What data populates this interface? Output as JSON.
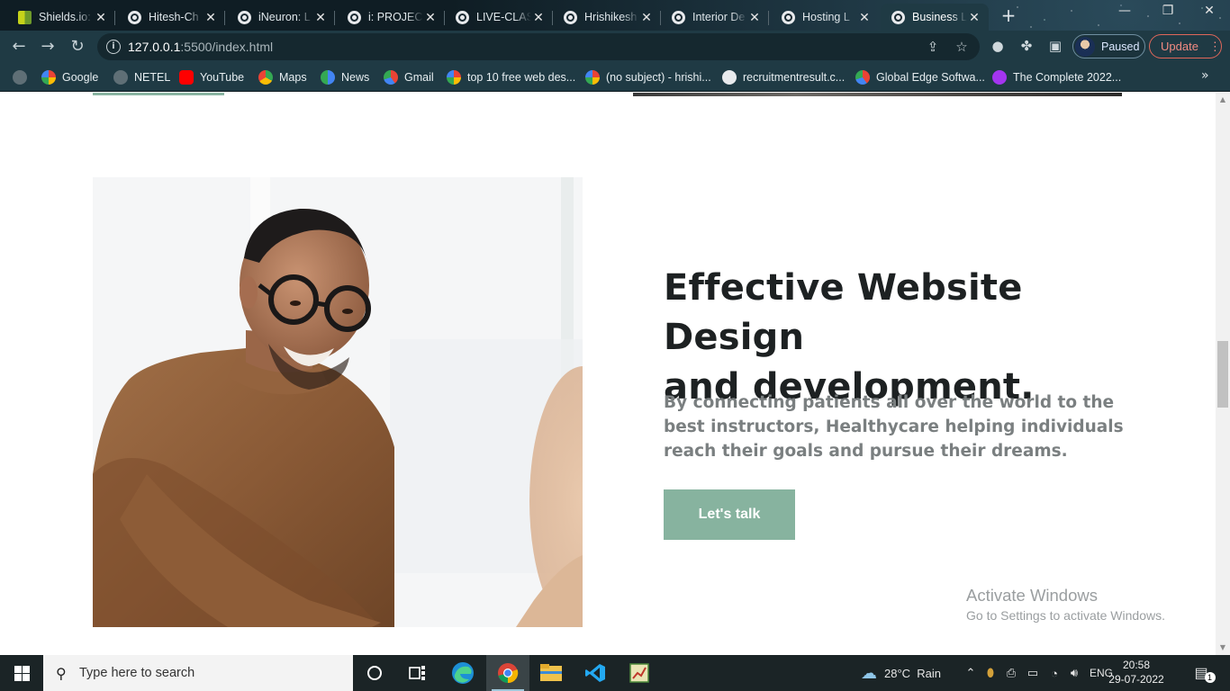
{
  "browser": {
    "tabs": [
      {
        "title": "Shields.io:",
        "icon": "shields-favicon"
      },
      {
        "title": "Hitesh-Ch",
        "icon": "globe-icon"
      },
      {
        "title": "iNeuron: L",
        "icon": "globe-icon"
      },
      {
        "title": "i: PROJECT",
        "icon": "globe-icon"
      },
      {
        "title": "LIVE-CLAS",
        "icon": "globe-icon"
      },
      {
        "title": "Hrishikesh",
        "icon": "globe-icon"
      },
      {
        "title": "Interior De",
        "icon": "globe-icon"
      },
      {
        "title": "Hosting L",
        "icon": "globe-icon"
      },
      {
        "title": "Business L",
        "icon": "globe-icon",
        "active": true
      }
    ],
    "url_host": "127.0.0.1",
    "url_path": ":5500/index.html",
    "profile_label": "Paused",
    "update_label": "Update",
    "bookmarks": [
      {
        "label": "",
        "icon": "globe-icon"
      },
      {
        "label": "Google",
        "icon": "google-icon"
      },
      {
        "label": "NETEL",
        "icon": "globe-icon"
      },
      {
        "label": "YouTube",
        "icon": "youtube-icon"
      },
      {
        "label": "Maps",
        "icon": "maps-icon"
      },
      {
        "label": "News",
        "icon": "news-icon"
      },
      {
        "label": "Gmail",
        "icon": "gmail-icon"
      },
      {
        "label": "top 10 free web des...",
        "icon": "google-icon"
      },
      {
        "label": "(no subject) - hrishi...",
        "icon": "google-icon"
      },
      {
        "label": "recruitmentresult.c...",
        "icon": "wordpress-icon"
      },
      {
        "label": "Global Edge Softwa...",
        "icon": "gmail-icon"
      },
      {
        "label": "The Complete 2022...",
        "icon": "udemy-icon"
      }
    ]
  },
  "page": {
    "headline_line1": "Effective Website Design",
    "headline_line2": "and development.",
    "paragraph": "By connecting patients all over the world to the best instructors, Healthycare helping individuals reach their goals and pursue their dreams.",
    "cta_label": "Let's talk",
    "accent_color": "#87b39f",
    "activate_title": "Activate Windows",
    "activate_sub": "Go to Settings to activate Windows."
  },
  "taskbar": {
    "search_placeholder": "Type here to search",
    "weather": "28°C  Rain",
    "language": "ENG",
    "time": "20:58",
    "date": "29-07-2022",
    "notification_count": "1"
  }
}
